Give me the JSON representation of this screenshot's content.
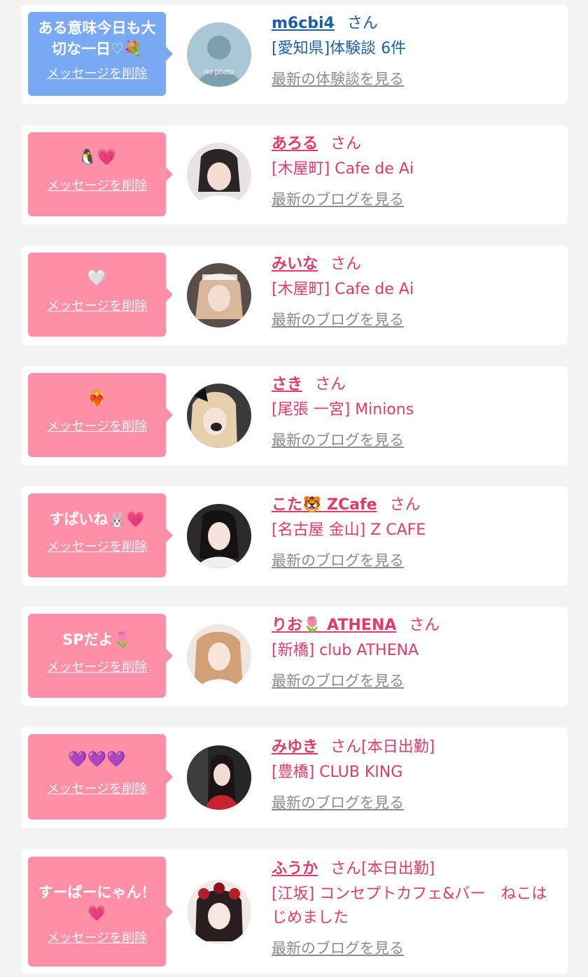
{
  "colors": {
    "bubble_blue": "#79a9f3",
    "bubble_pink": "#ff8fa6",
    "name_blue": "#1a5fa8",
    "name_pink": "#e23b6a",
    "link_gray": "#8b8b8b"
  },
  "delete_label": "メッセージを削除",
  "san_label": "さん",
  "items": [
    {
      "message": "ある意味今日も大切な一日♡💐",
      "name": "m6cbi4",
      "store": "[愛知県]体験談 6件",
      "latest_label": "最新の体験談を見る",
      "avatar_text": "no photo"
    },
    {
      "message": "🐧💗",
      "name": "あろる",
      "store": "[木屋町] Cafe de Ai",
      "latest_label": "最新のブログを見る"
    },
    {
      "message": "🤍",
      "name": "みいな",
      "store": "[木屋町] Cafe de Ai",
      "latest_label": "最新のブログを見る"
    },
    {
      "message": "❤️‍🔥",
      "name": "さき",
      "store": "[尾張 一宮] Minions",
      "latest_label": "最新のブログを見る"
    },
    {
      "message": "すぱいね🐰💗",
      "name": "こた🐯 ZCafe",
      "store": "[名古屋 金山] Z CAFE",
      "latest_label": "最新のブログを見る"
    },
    {
      "message": "SPだよ🌷",
      "name": "りお🌷 ATHENA",
      "store": "[新橋] club ATHENA",
      "latest_label": "最新のブログを見る"
    },
    {
      "message": "💜💜💜",
      "name": "みゆき",
      "status": "[本日出勤]",
      "store": "[豊橋] CLUB KING",
      "latest_label": "最新のブログを見る"
    },
    {
      "message": "すーぱーにゃん！💗",
      "name": "ふうか",
      "status": "[本日出勤]",
      "store": "[江坂] コンセプトカフェ&バー　ねこはじめました",
      "latest_label": "最新のブログを見る"
    }
  ]
}
